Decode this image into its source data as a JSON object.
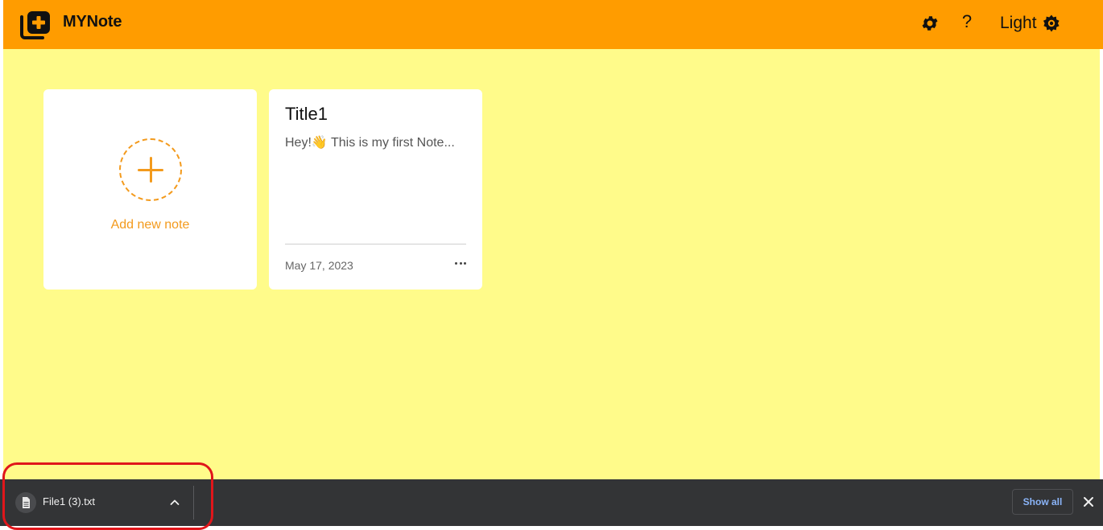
{
  "app": {
    "title": "MYNote",
    "logo_icon": "note-add-icon",
    "brand_color": "#ff9c00"
  },
  "header": {
    "settings_icon": "gear-icon",
    "help_label": "?",
    "theme_label": "Light",
    "theme_icon": "sun-gear-icon"
  },
  "main": {
    "background": "#fffb8a",
    "add_card": {
      "label": "Add new note",
      "icon": "plus-circle-icon",
      "accent": "#f39a1c"
    },
    "notes": [
      {
        "title": "Title1",
        "body": "Hey!👋 This is my first Note...",
        "date": "May 17, 2023",
        "menu_icon": "more-horizontal-icon"
      }
    ]
  },
  "download_bar": {
    "file_name": "File1 (3).txt",
    "file_icon": "document-icon",
    "chevron_icon": "chevron-up-icon",
    "show_all_label": "Show all",
    "close_icon": "close-icon"
  }
}
